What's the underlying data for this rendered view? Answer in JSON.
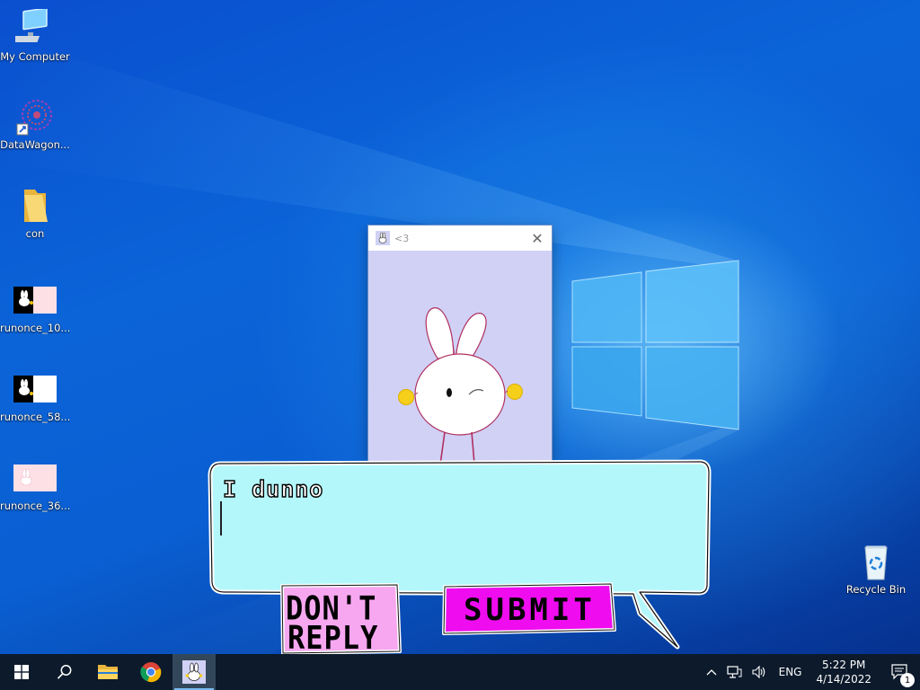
{
  "desktop": {
    "icons": [
      {
        "label": "My Computer",
        "icon": "computer-icon"
      },
      {
        "label": "DataWagon...",
        "icon": "datawagon-shortcut-icon"
      },
      {
        "label": "con",
        "icon": "folder-icon"
      },
      {
        "label": "runonce_10...",
        "icon": "runonce-image-icon"
      },
      {
        "label": "runonce_58...",
        "icon": "runonce-image-icon"
      },
      {
        "label": "runonce_36...",
        "icon": "runonce-image-icon"
      },
      {
        "label": "Recycle Bin",
        "icon": "recycle-bin-icon"
      }
    ]
  },
  "window": {
    "title": "<3",
    "close_icon": "close-icon",
    "background": "#d0d1f5"
  },
  "message": {
    "text": "I dunno",
    "bubble_color": "#b3f7fb"
  },
  "buttons": {
    "dont_reply": {
      "line1": "DON'T",
      "line2": "REPLY",
      "color": "#f7a7f0"
    },
    "submit": {
      "label": "SUBMIT",
      "color": "#ef0cef"
    }
  },
  "taskbar": {
    "items": [
      {
        "name": "start",
        "icon": "windows-logo-icon"
      },
      {
        "name": "search",
        "icon": "search-icon"
      },
      {
        "name": "file-explorer",
        "icon": "folder-icon"
      },
      {
        "name": "chrome",
        "icon": "chrome-icon"
      },
      {
        "name": "bunny-app",
        "icon": "bunny-app-icon",
        "active": true
      }
    ],
    "tray": {
      "language": "ENG",
      "time": "5:22 PM",
      "date": "4/14/2022",
      "notification_count": "1"
    }
  }
}
